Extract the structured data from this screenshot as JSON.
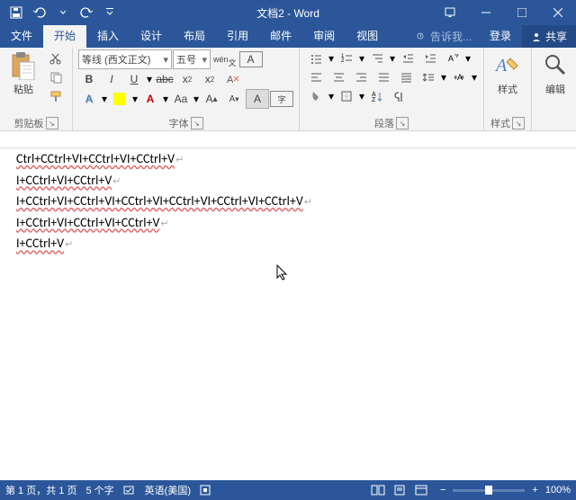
{
  "title": "文档2 - Word",
  "tabs": {
    "file": "文件",
    "home": "开始",
    "insert": "插入",
    "design": "设计",
    "layout": "布局",
    "references": "引用",
    "mailings": "邮件",
    "review": "审阅",
    "view": "视图",
    "tellme": "告诉我...",
    "signin": "登录",
    "share": "共享"
  },
  "ribbon": {
    "clipboard": {
      "paste": "粘贴",
      "label": "剪贴板"
    },
    "font": {
      "family": "等线 (西文正文)",
      "size": "五号",
      "ruby": "wén",
      "border": "A",
      "label": "字体"
    },
    "paragraph": {
      "label": "段落"
    },
    "styles": {
      "btn": "样式",
      "label": "样式"
    },
    "editing": {
      "btn": "编辑"
    }
  },
  "document": {
    "lines": [
      "Ctrl+CCtrl+VI+CCtrl+VI+CCtrl+V",
      "I+CCtrl+VI+CCtrl+V",
      "I+CCtrl+VI+CCtrl+VI+CCtrl+VI+CCtrl+VI+CCtrl+VI+CCtrl+V",
      "I+CCtrl+VI+CCtrl+VI+CCtrl+V",
      "I+CCtrl+V"
    ]
  },
  "status": {
    "page": "第 1 页，共 1 页",
    "words": "5 个字",
    "lang": "英语(美国)",
    "zoom": "100%"
  }
}
